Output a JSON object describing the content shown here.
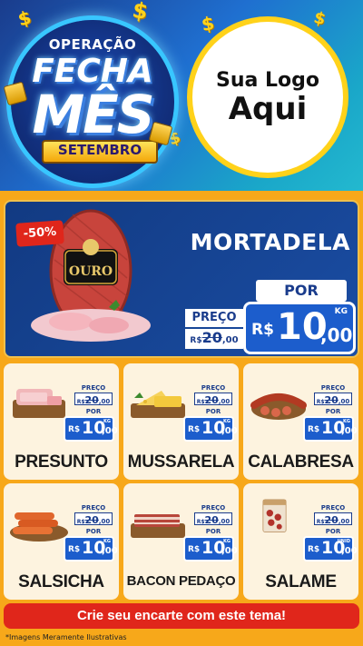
{
  "header": {
    "badge": {
      "line1": "OPERAÇÃO",
      "line2": "FECHA",
      "line3": "MÊS",
      "month": "SETEMBRO"
    },
    "logo": {
      "line1": "Sua Logo",
      "line2": "Aqui"
    },
    "currency_symbol": "$"
  },
  "featured": {
    "discount": "-50%",
    "name": "MORTADELA",
    "old_label": "PREÇO",
    "old_currency": "R$",
    "old_int": "20",
    "old_cents": ",00",
    "new_label": "POR",
    "new_currency": "R$",
    "new_int": "10",
    "new_cents": ",00",
    "unit": "KG",
    "brand": "OURO"
  },
  "products": [
    {
      "name": "PRESUNTO",
      "preco_label": "PREÇO",
      "old_currency": "R$",
      "old_int": "20",
      "old_cents": ",00",
      "por_label": "POR",
      "currency": "R$",
      "int": "10",
      "cents": ",00",
      "unit": "KG"
    },
    {
      "name": "MUSSARELA",
      "preco_label": "PREÇO",
      "old_currency": "R$",
      "old_int": "20",
      "old_cents": ",00",
      "por_label": "POR",
      "currency": "R$",
      "int": "10",
      "cents": ",00",
      "unit": "KG"
    },
    {
      "name": "CALABRESA",
      "preco_label": "PREÇO",
      "old_currency": "R$",
      "old_int": "20",
      "old_cents": ",00",
      "por_label": "POR",
      "currency": "R$",
      "int": "10",
      "cents": ",00",
      "unit": "KG"
    },
    {
      "name": "SALSICHA",
      "preco_label": "PREÇO",
      "old_currency": "R$",
      "old_int": "20",
      "old_cents": ",00",
      "por_label": "POR",
      "currency": "R$",
      "int": "10",
      "cents": ",00",
      "unit": "KG"
    },
    {
      "name": "BACON PEDAÇO",
      "preco_label": "PREÇO",
      "old_currency": "R$",
      "old_int": "20",
      "old_cents": ",00",
      "por_label": "POR",
      "currency": "R$",
      "int": "10",
      "cents": ",00",
      "unit": "KG"
    },
    {
      "name": "SALAME",
      "preco_label": "PREÇO",
      "old_currency": "R$",
      "old_int": "20",
      "old_cents": ",00",
      "por_label": "POR",
      "currency": "R$",
      "int": "10",
      "cents": ",00",
      "unit": "UNID"
    }
  ],
  "cta": "Crie seu encarte com este tema!",
  "footnote": "*Imagens Meramente Ilustrativas",
  "colors": {
    "primary_blue": "#1c5dcc",
    "accent_yellow": "#ffd21a",
    "background_orange": "#f7a81a",
    "discount_red": "#e0261b"
  }
}
